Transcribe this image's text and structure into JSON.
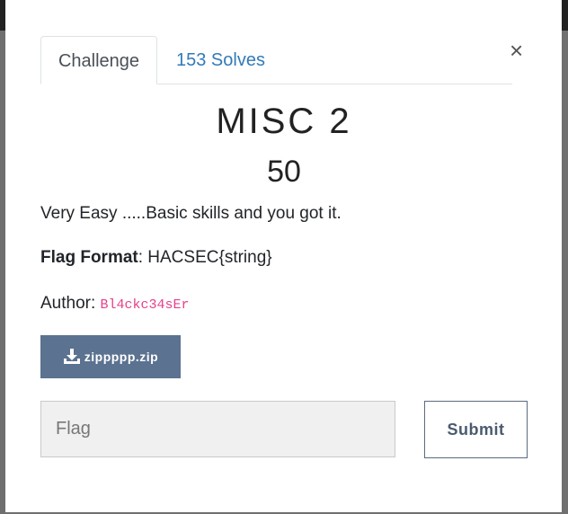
{
  "tabs": [
    {
      "label": "Challenge"
    },
    {
      "label": "153 Solves"
    }
  ],
  "close_glyph": "×",
  "challenge": {
    "name": "MISC 2",
    "value": "50",
    "description": "Very Easy .....Basic skills and you got it.",
    "flag_format_label": "Flag Format",
    "flag_format_value": ": HACSEC{string}",
    "author_label": "Author: ",
    "author_name": "Bl4ckc34sEr"
  },
  "file": {
    "label": "zippppp.zip",
    "icon": "download-icon"
  },
  "submission": {
    "placeholder": "Flag",
    "value": "",
    "submit_label": "Submit"
  },
  "colors": {
    "tab_link": "#337ab7",
    "download_button": "#5b7290",
    "author_code": "#e83e8c"
  }
}
